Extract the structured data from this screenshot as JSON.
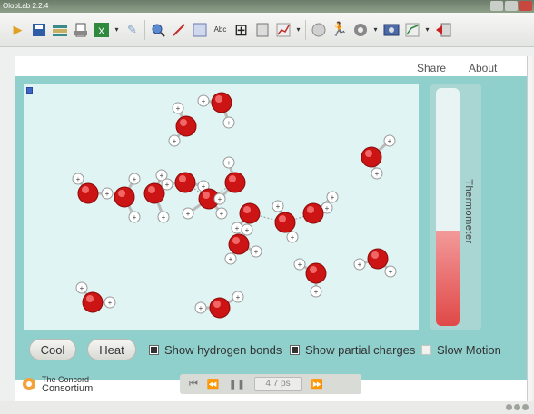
{
  "window": {
    "title": "OlobLab 2.2.4"
  },
  "toolbar": {
    "icons": [
      "open-icon",
      "save-icon",
      "stack-icon",
      "print-icon",
      "excel-icon",
      "dropdown",
      "eraser-icon",
      "zoom-icon",
      "chart-icon",
      "grid-icon",
      "spellcheck-icon",
      "crop-icon",
      "notes-icon",
      "graph-icon",
      "dropdown",
      "disk-icon",
      "runner-icon",
      "settings-icon",
      "dropdown",
      "camera-icon",
      "chart2-icon",
      "dropdown",
      "exit-icon"
    ]
  },
  "topbar": {
    "share": "Share",
    "about": "About"
  },
  "simulation": {
    "thermometer_label": "Thermometer",
    "thermometer_level": 0.4,
    "colors": {
      "oxygen": "#cc1414",
      "hydrogen": "#ffffff",
      "background": "#dff4f3",
      "frame": "#8fcfcc"
    }
  },
  "controls": {
    "cool": "Cool",
    "heat": "Heat",
    "hydrogen_bonds": {
      "label": "Show hydrogen bonds",
      "checked": true
    },
    "partial_charges": {
      "label": "Show partial charges",
      "checked": true
    },
    "slow_motion": {
      "label": "Slow Motion",
      "checked": false
    }
  },
  "footer": {
    "logo_line1": "The Concord",
    "logo_line2": "Consortium",
    "time": "4.7 ps"
  }
}
